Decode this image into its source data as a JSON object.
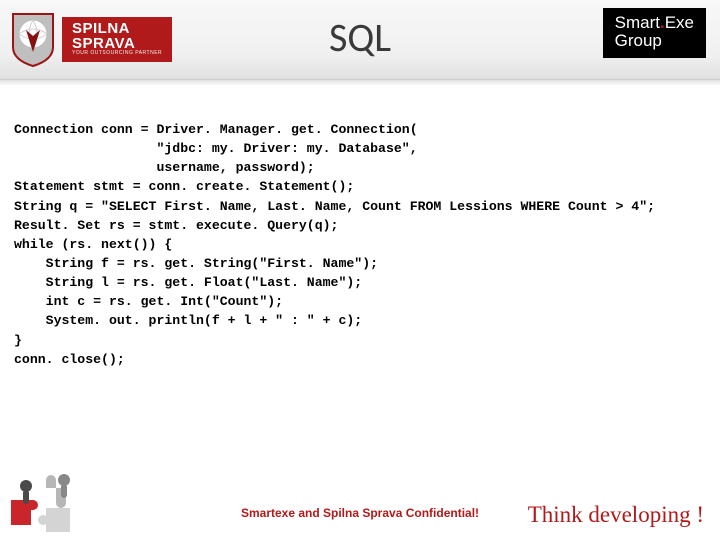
{
  "header": {
    "title": "SQL",
    "left_logo": {
      "line1": "SPILNA",
      "line2": "SPRAVA",
      "tagline": "YOUR OUTSOURCING PARTNER"
    },
    "right_logo": {
      "line1a": "Smart",
      "dot": ".",
      "line1b": "Exe",
      "line2": "Group"
    }
  },
  "code": {
    "l01": "Connection conn = Driver. Manager. get. Connection(",
    "l02": "                  \"jdbc: my. Driver: my. Database\",",
    "l03": "                  username, password);",
    "l04": "Statement stmt = conn. create. Statement();",
    "l05": "String q = \"SELECT First. Name, Last. Name, Count FROM Lessions WHERE Count > 4\";",
    "l06": "Result. Set rs = stmt. execute. Query(q);",
    "l07": "while (rs. next()) {",
    "l08": "    String f = rs. get. String(\"First. Name\");",
    "l09": "    String l = rs. get. Float(\"Last. Name\");",
    "l10": "    int c = rs. get. Int(\"Count\");",
    "l11": "    System. out. println(f + l + \" : \" + c);",
    "l12": "}",
    "l13": "conn. close();"
  },
  "footer": {
    "confidential": "Smartexe and Spilna Sprava Confidential!",
    "tagline": "Think developing !"
  }
}
